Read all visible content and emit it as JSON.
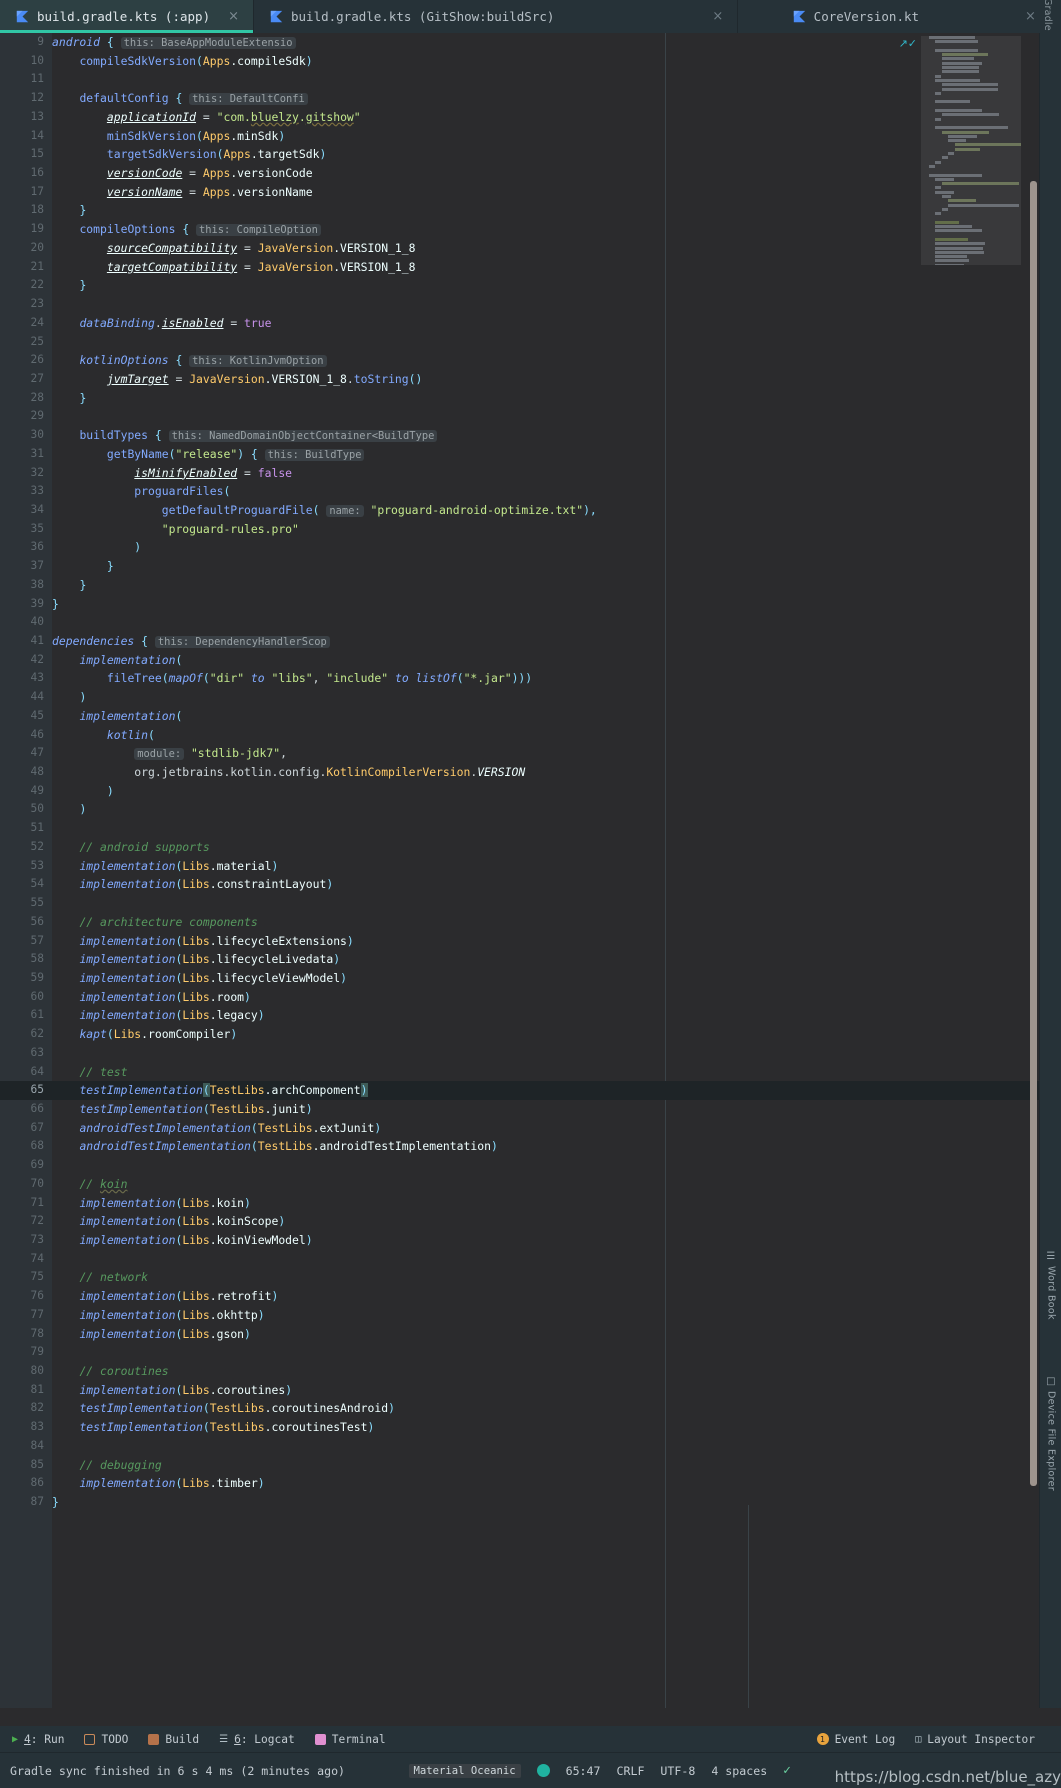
{
  "window": {
    "theme_accent": "#31c6a5",
    "editor_bg": "#2b2b2d",
    "chrome_bg": "#263238"
  },
  "tabs": [
    {
      "label": "build.gradle.kts (:app)",
      "icon": "kotlin-icon",
      "close": "×",
      "active": true
    },
    {
      "label": "build.gradle.kts (GitShow:buildSrc)",
      "icon": "kotlin-icon",
      "close": "×",
      "active": false
    },
    {
      "label": "CoreVersion.kt",
      "icon": "kotlin-icon",
      "close": "×",
      "active": false
    }
  ],
  "right_rail": {
    "top_label": "Gradle",
    "items": [
      {
        "label": "Word Book",
        "icon": "book-icon"
      },
      {
        "label": "Device File Explorer",
        "icon": "device-icon"
      }
    ]
  },
  "editor": {
    "first_line": 9,
    "current_line": 65,
    "inspect_icon": "inspections-widget-icon",
    "lines": [
      {
        "n": 9,
        "html": "<span class=\"fn\">android</span> <span class=\"punc\">{</span> <span class=\"hint\">this: BaseAppModuleExtensio</span>"
      },
      {
        "n": 10,
        "html": "    <span class=\"fnn\">compileSdkVersion</span><span class=\"punc\">(</span><span class=\"obj\">Apps</span><span class=\"id\">.compileSdk</span><span class=\"punc\">)</span>"
      },
      {
        "n": 11,
        "html": ""
      },
      {
        "n": 12,
        "html": "    <span class=\"fnn\">defaultConfig</span> <span class=\"punc\">{</span> <span class=\"hint\">this: DefaultConfi</span>"
      },
      {
        "n": 13,
        "html": "        <span class=\"prop\">applicationId</span> <span class=\"plain\">=</span> <span class=\"str\">\"com.<span class=\"squig\">bluelzy</span>.<span class=\"squig\">gitshow</span>\"</span>"
      },
      {
        "n": 14,
        "html": "        <span class=\"fnn\">minSdkVersion</span><span class=\"punc\">(</span><span class=\"obj\">Apps</span><span class=\"id\">.minSdk</span><span class=\"punc\">)</span>"
      },
      {
        "n": 15,
        "html": "        <span class=\"fnn\">targetSdkVersion</span><span class=\"punc\">(</span><span class=\"obj\">Apps</span><span class=\"id\">.targetSdk</span><span class=\"punc\">)</span>"
      },
      {
        "n": 16,
        "html": "        <span class=\"prop\">versionCode</span> <span class=\"plain\">=</span> <span class=\"obj\">Apps</span><span class=\"id\">.versionCode</span>"
      },
      {
        "n": 17,
        "html": "        <span class=\"prop\">versionName</span> <span class=\"plain\">=</span> <span class=\"obj\">Apps</span><span class=\"id\">.versionName</span>"
      },
      {
        "n": 18,
        "html": "    <span class=\"punc\">}</span>"
      },
      {
        "n": 19,
        "html": "    <span class=\"fnn\">compileOptions</span> <span class=\"punc\">{</span> <span class=\"hint\">this: CompileOption</span>"
      },
      {
        "n": 20,
        "html": "        <span class=\"prop\">sourceCompatibility</span> <span class=\"plain\">=</span> <span class=\"obj\">JavaVersion</span><span class=\"id\">.VERSION_1_8</span>"
      },
      {
        "n": 21,
        "html": "        <span class=\"prop\">targetCompatibility</span> <span class=\"plain\">=</span> <span class=\"obj\">JavaVersion</span><span class=\"id\">.VERSION_1_8</span>"
      },
      {
        "n": 22,
        "html": "    <span class=\"punc\">}</span>"
      },
      {
        "n": 23,
        "html": ""
      },
      {
        "n": 24,
        "html": "    <span class=\"fn\">dataBinding</span><span class=\"plain\">.</span><span class=\"prop\">isEnabled</span> <span class=\"plain\">=</span> <span class=\"kw\">true</span>"
      },
      {
        "n": 25,
        "html": ""
      },
      {
        "n": 26,
        "html": "    <span class=\"fn\">kotlinOptions</span> <span class=\"punc\">{</span> <span class=\"hint\">this: KotlinJvmOption</span>"
      },
      {
        "n": 27,
        "html": "        <span class=\"prop\">jvmTarget</span> <span class=\"plain\">=</span> <span class=\"obj\">JavaVersion</span><span class=\"id\">.VERSION_1_8</span><span class=\"plain\">.</span><span class=\"fnn\">toString</span><span class=\"punc\">()</span>"
      },
      {
        "n": 28,
        "html": "    <span class=\"punc\">}</span>"
      },
      {
        "n": 29,
        "html": ""
      },
      {
        "n": 30,
        "html": "    <span class=\"fnn\">buildTypes</span> <span class=\"punc\">{</span> <span class=\"hint\">this: NamedDomainObjectContainer&lt;BuildType</span>"
      },
      {
        "n": 31,
        "html": "        <span class=\"fnn\">getByName</span><span class=\"punc\">(</span><span class=\"str\">\"release\"</span><span class=\"punc\">)</span> <span class=\"punc\">{</span> <span class=\"hint\">this: BuildType</span>"
      },
      {
        "n": 32,
        "html": "            <span class=\"prop\">isMinifyEnabled</span> <span class=\"plain\">=</span> <span class=\"kw\">false</span>"
      },
      {
        "n": 33,
        "html": "            <span class=\"fnn\">proguardFiles</span><span class=\"punc\">(</span>"
      },
      {
        "n": 34,
        "html": "                <span class=\"fnn\">getDefaultProguardFile</span><span class=\"punc\">(</span> <span class=\"hint2\">name:</span> <span class=\"str\">\"proguard-android-optimize.txt\"</span><span class=\"punc\">),</span>"
      },
      {
        "n": 35,
        "html": "                <span class=\"str\">\"proguard-rules.pro\"</span>"
      },
      {
        "n": 36,
        "html": "            <span class=\"punc\">)</span>"
      },
      {
        "n": 37,
        "html": "        <span class=\"punc\">}</span>"
      },
      {
        "n": 38,
        "html": "    <span class=\"punc\">}</span>"
      },
      {
        "n": 39,
        "html": "<span class=\"punc\">}</span>"
      },
      {
        "n": 40,
        "html": ""
      },
      {
        "n": 41,
        "html": "<span class=\"fn\">dependencies</span> <span class=\"punc\">{</span> <span class=\"hint\">this: DependencyHandlerScop</span>"
      },
      {
        "n": 42,
        "html": "    <span class=\"fn\">implementation</span><span class=\"punc\">(</span>"
      },
      {
        "n": 43,
        "html": "        <span class=\"fnn\">fileTree</span><span class=\"punc\">(</span><span class=\"fn\">mapOf</span><span class=\"punc\">(</span><span class=\"str\">\"dir\"</span> <span class=\"fn\">to</span> <span class=\"str\">\"libs\"</span><span class=\"plain\">,</span> <span class=\"str\">\"include\"</span> <span class=\"fn\">to</span> <span class=\"fn\">listOf</span><span class=\"punc\">(</span><span class=\"str\">\"*.jar\"</span><span class=\"punc\">)))</span>"
      },
      {
        "n": 44,
        "html": "    <span class=\"punc\">)</span>"
      },
      {
        "n": 45,
        "html": "    <span class=\"fn\">implementation</span><span class=\"punc\">(</span>"
      },
      {
        "n": 46,
        "html": "        <span class=\"fn\">kotlin</span><span class=\"punc\">(</span>"
      },
      {
        "n": 47,
        "html": "            <span class=\"hint2\">module:</span> <span class=\"str\">\"stdlib-jdk7\"</span><span class=\"plain\">,</span>"
      },
      {
        "n": 48,
        "html": "            <span class=\"plain\">org.jetbrains.kotlin.config.</span><span class=\"obj\">KotlinCompilerVersion</span><span class=\"plain\">.</span><span class=\"prop\" style=\"text-decoration:none\">VERSION</span>"
      },
      {
        "n": 49,
        "html": "        <span class=\"punc\">)</span>"
      },
      {
        "n": 50,
        "html": "    <span class=\"punc\">)</span>"
      },
      {
        "n": 51,
        "html": ""
      },
      {
        "n": 52,
        "html": "    <span class=\"cmt\">// android supports</span>"
      },
      {
        "n": 53,
        "html": "    <span class=\"fn\">implementation</span><span class=\"punc\">(</span><span class=\"obj\">Libs</span><span class=\"id\">.material</span><span class=\"punc\">)</span>"
      },
      {
        "n": 54,
        "html": "    <span class=\"fn\">implementation</span><span class=\"punc\">(</span><span class=\"obj\">Libs</span><span class=\"id\">.constraintLayout</span><span class=\"punc\">)</span>"
      },
      {
        "n": 55,
        "html": ""
      },
      {
        "n": 56,
        "html": "    <span class=\"cmt\">// architecture components</span>"
      },
      {
        "n": 57,
        "html": "    <span class=\"fn\">implementation</span><span class=\"punc\">(</span><span class=\"obj\">Libs</span><span class=\"id\">.lifecycleExtensions</span><span class=\"punc\">)</span>"
      },
      {
        "n": 58,
        "html": "    <span class=\"fn\">implementation</span><span class=\"punc\">(</span><span class=\"obj\">Libs</span><span class=\"id\">.lifecycleLivedata</span><span class=\"punc\">)</span>"
      },
      {
        "n": 59,
        "html": "    <span class=\"fn\">implementation</span><span class=\"punc\">(</span><span class=\"obj\">Libs</span><span class=\"id\">.lifecycleViewModel</span><span class=\"punc\">)</span>"
      },
      {
        "n": 60,
        "html": "    <span class=\"fn\">implementation</span><span class=\"punc\">(</span><span class=\"obj\">Libs</span><span class=\"id\">.room</span><span class=\"punc\">)</span>"
      },
      {
        "n": 61,
        "html": "    <span class=\"fn\">implementation</span><span class=\"punc\">(</span><span class=\"obj\">Libs</span><span class=\"id\">.legacy</span><span class=\"punc\">)</span>"
      },
      {
        "n": 62,
        "html": "    <span class=\"fn\">kapt</span><span class=\"punc\">(</span><span class=\"obj\">Libs</span><span class=\"id\">.roomCompiler</span><span class=\"punc\">)</span>"
      },
      {
        "n": 63,
        "html": ""
      },
      {
        "n": 64,
        "html": "    <span class=\"cmt\">// test</span>"
      },
      {
        "n": 65,
        "html": "    <span class=\"fn\">testImplementation</span><span class=\"brk\">(</span><span class=\"obj\">TestLibs</span><span class=\"id\">.archCompoment</span><span class=\"brk\">)</span>",
        "current": true
      },
      {
        "n": 66,
        "html": "    <span class=\"fn\">testImplementation</span><span class=\"punc\">(</span><span class=\"obj\">TestLibs</span><span class=\"id\">.junit</span><span class=\"punc\">)</span>"
      },
      {
        "n": 67,
        "html": "    <span class=\"fn\">androidTestImplementation</span><span class=\"punc\">(</span><span class=\"obj\">TestLibs</span><span class=\"id\">.extJunit</span><span class=\"punc\">)</span>"
      },
      {
        "n": 68,
        "html": "    <span class=\"fn\">androidTestImplementation</span><span class=\"punc\">(</span><span class=\"obj\">TestLibs</span><span class=\"id\">.androidTestImplementation</span><span class=\"punc\">)</span>"
      },
      {
        "n": 69,
        "html": ""
      },
      {
        "n": 70,
        "html": "    <span class=\"cmt\">// <span class=\"squig2\">koin</span></span>"
      },
      {
        "n": 71,
        "html": "    <span class=\"fn\">implementation</span><span class=\"punc\">(</span><span class=\"obj\">Libs</span><span class=\"id\">.koin</span><span class=\"punc\">)</span>"
      },
      {
        "n": 72,
        "html": "    <span class=\"fn\">implementation</span><span class=\"punc\">(</span><span class=\"obj\">Libs</span><span class=\"id\">.koinScope</span><span class=\"punc\">)</span>"
      },
      {
        "n": 73,
        "html": "    <span class=\"fn\">implementation</span><span class=\"punc\">(</span><span class=\"obj\">Libs</span><span class=\"id\">.koinViewModel</span><span class=\"punc\">)</span>"
      },
      {
        "n": 74,
        "html": ""
      },
      {
        "n": 75,
        "html": "    <span class=\"cmt\">// network</span>"
      },
      {
        "n": 76,
        "html": "    <span class=\"fn\">implementation</span><span class=\"punc\">(</span><span class=\"obj\">Libs</span><span class=\"id\">.retrofit</span><span class=\"punc\">)</span>"
      },
      {
        "n": 77,
        "html": "    <span class=\"fn\">implementation</span><span class=\"punc\">(</span><span class=\"obj\">Libs</span><span class=\"id\">.okhttp</span><span class=\"punc\">)</span>"
      },
      {
        "n": 78,
        "html": "    <span class=\"fn\">implementation</span><span class=\"punc\">(</span><span class=\"obj\">Libs</span><span class=\"id\">.gson</span><span class=\"punc\">)</span>"
      },
      {
        "n": 79,
        "html": ""
      },
      {
        "n": 80,
        "html": "    <span class=\"cmt\">// coroutines</span>"
      },
      {
        "n": 81,
        "html": "    <span class=\"fn\">implementation</span><span class=\"punc\">(</span><span class=\"obj\">Libs</span><span class=\"id\">.coroutines</span><span class=\"punc\">)</span>"
      },
      {
        "n": 82,
        "html": "    <span class=\"fn\">testImplementation</span><span class=\"punc\">(</span><span class=\"obj\">TestLibs</span><span class=\"id\">.coroutinesAndroid</span><span class=\"punc\">)</span>"
      },
      {
        "n": 83,
        "html": "    <span class=\"fn\">testImplementation</span><span class=\"punc\">(</span><span class=\"obj\">TestLibs</span><span class=\"id\">.coroutinesTest</span><span class=\"punc\">)</span>"
      },
      {
        "n": 84,
        "html": ""
      },
      {
        "n": 85,
        "html": "    <span class=\"cmt\">// debugging</span>"
      },
      {
        "n": 86,
        "html": "    <span class=\"fn\">implementation</span><span class=\"punc\">(</span><span class=\"obj\">Libs</span><span class=\"id\">.timber</span><span class=\"punc\">)</span>"
      },
      {
        "n": 87,
        "html": "<span class=\"punc\">}</span>"
      }
    ]
  },
  "bottom_toolwindows": [
    {
      "label": "4: Run",
      "underline": "4",
      "icon": "run-icon",
      "color": "#4caf50"
    },
    {
      "label": "TODO",
      "icon": "todo-icon",
      "color": "#c98a5a"
    },
    {
      "label": "Build",
      "icon": "build-icon",
      "color": "#c98a5a"
    },
    {
      "label": "6: Logcat",
      "underline": "6",
      "icon": "logcat-icon",
      "color": "#b0bec5"
    },
    {
      "label": "Terminal",
      "icon": "terminal-icon",
      "color": "#e08fd0"
    }
  ],
  "bottom_right_items": [
    {
      "label": "Event Log",
      "icon": "notification-badge-icon",
      "badge": "1"
    },
    {
      "label": "Layout Inspector",
      "icon": "layout-inspector-icon"
    }
  ],
  "status": {
    "message": "Gradle sync finished in 6 s 4 ms (2 minutes ago)",
    "theme_chip": "Material Oceanic",
    "caret": "65:47",
    "line_separator": "CRLF",
    "encoding": "UTF-8",
    "indent": "4 spaces",
    "vcs_icon": "git-branch-icon",
    "watermark": "https://blog.csdn.net/blue_azy"
  }
}
